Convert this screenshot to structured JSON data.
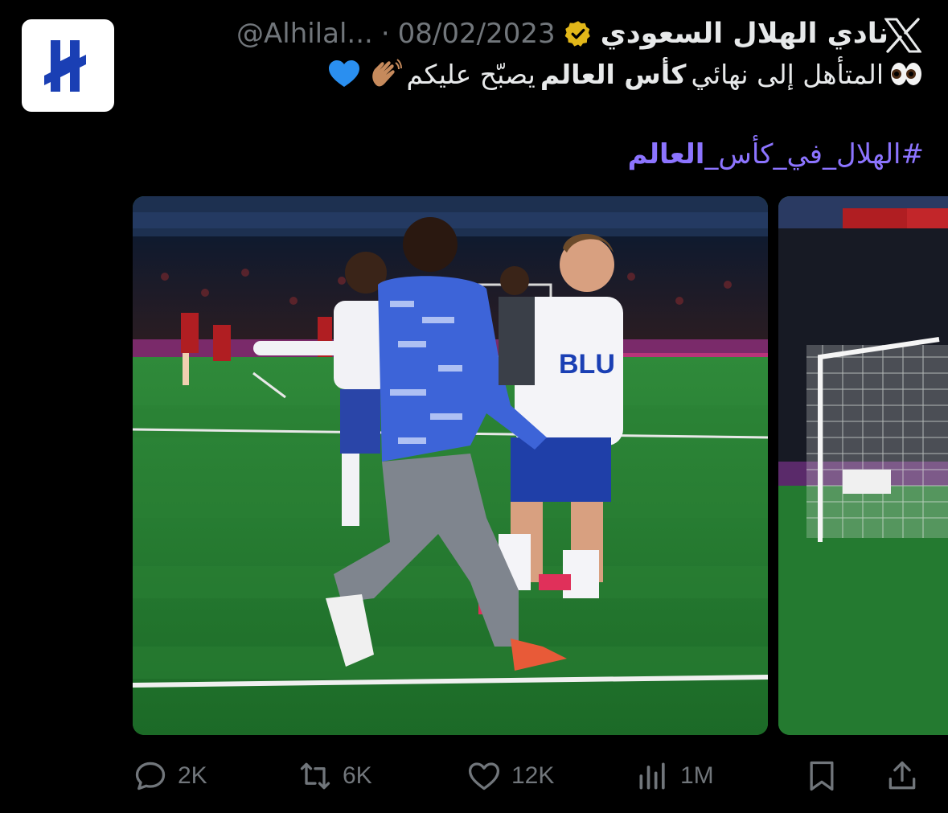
{
  "tweet": {
    "display_name": "نادي الهلال السعودي",
    "handle": "@Alhilal...",
    "separator": "·",
    "date": "08/02/2023",
    "text_part1": "المتأهل إلى نهائي",
    "text_bold": "كأس العالم",
    "text_part2": "يصبّح عليكم",
    "hashtag_prefix": "#الهلال_في_كأس_",
    "hashtag_bold": "العالم",
    "emojis": [
      "eyes-icon",
      "waving-hand-icon",
      "blue-heart-icon"
    ]
  },
  "media": {
    "main_image": "celebrating-players-photo",
    "second_image": "goal-net-photo"
  },
  "actions": {
    "replies": "2K",
    "reposts": "6K",
    "likes": "12K",
    "views": "1M"
  },
  "colors": {
    "background": "#000000",
    "text": "#e7e9ea",
    "muted": "#71767b",
    "hashtag": "#8c74ff",
    "verified_gold": "#e2b719",
    "brand_blue": "#1a3fb4"
  }
}
